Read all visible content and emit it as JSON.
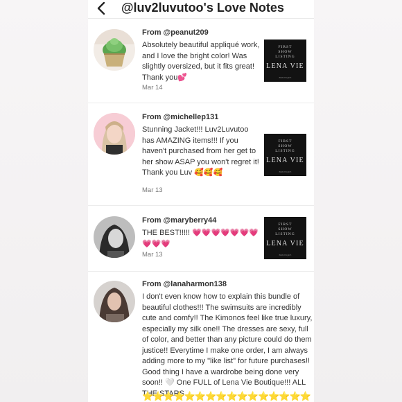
{
  "header": {
    "title": "@luv2luvutoo's Love Notes",
    "back_icon": "chevron-left-icon"
  },
  "notes": [
    {
      "from": "From @peanut209",
      "text": "Absolutely beautiful appliqué work, and I love the bright color! Was slightly oversized, but it fits great! Thank you💕",
      "date": "Mar 14",
      "thumb": {
        "top": "FIRST\nSHOW\nLISTING",
        "brand": "LENA VIE",
        "bottom": "BOUTIQUE"
      }
    },
    {
      "from": "From @michellep131",
      "text": "Stunning Jacket!!! Luv2Luvutoo has AMAZING items!!! If you haven't purchased from her get to her show ASAP you won't regret it! Thank you Luv 🥰🥰🥰",
      "date": "Mar 13",
      "thumb": {
        "top": "FIRST\nSHOW\nLISTING",
        "brand": "LENA VIE",
        "bottom": "BOUTIQUE"
      }
    },
    {
      "from": "From @maryberry44",
      "text": "THE BEST!!!!! 💗💗💗💗💗💗💗💗💗💗",
      "date": "Mar 13",
      "thumb": {
        "top": "FIRST\nSHOW\nLISTING",
        "brand": "LENA VIE",
        "bottom": "BOUTIQUE"
      }
    },
    {
      "from": "From @lanaharmon138",
      "text": "I don't even know how to explain this bundle of beautiful clothes!!! The swimsuits are incredibly cute and comfy!! The Kimonos feel like true luxury, especially my silk one!! The dresses are sexy, full of color, and better than any picture could do them justice!! Everytime I make one order, I am always adding more to my \"like list\" for future purchases!! Good thing I have a wardrobe being done very soon!! 🤍 One FULL of Lena Vie Boutique!!! ALL THE STARS",
      "stars": "⭐⭐⭐⭐⭐⭐⭐⭐⭐⭐⭐⭐⭐⭐⭐⭐"
    }
  ],
  "colors": {
    "background_side": "#f4f2f3",
    "text": "#333333",
    "date": "#777777",
    "heart": "#e83e9a",
    "star": "#f3c11b"
  }
}
